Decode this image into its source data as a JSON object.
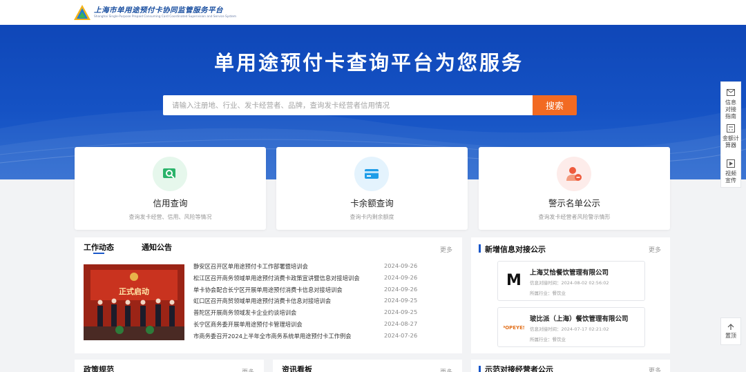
{
  "header": {
    "title": "上海市单用途预付卡协同监管服务平台",
    "subtitle": "Shanghai Single-Purpose Prepaid Consuming Card Coordinated Supervision and Service System"
  },
  "hero": {
    "title": "单用途预付卡查询平台为您服务",
    "search_placeholder": "请输入注册地、行业、发卡经营者、品牌，查询发卡经营者信用情况",
    "search_button": "搜索"
  },
  "cards": [
    {
      "title": "信用查询",
      "desc": "查询发卡经营、信用、风险等情况",
      "icon": "credit-search-icon",
      "color": "#2ab36a"
    },
    {
      "title": "卡余额查询",
      "desc": "查询卡内剩余额度",
      "icon": "card-balance-icon",
      "color": "#1f9de8"
    },
    {
      "title": "警示名单公示",
      "desc": "查询发卡经营者风险警示情形",
      "icon": "warning-person-icon",
      "color": "#ee5b3d"
    }
  ],
  "float": {
    "items": [
      "信息对接指南",
      "金额计算器",
      "视频宣传"
    ],
    "top": "置顶"
  },
  "news": {
    "tabs": [
      "工作动态",
      "通知公告"
    ],
    "more": "更多",
    "image_text": "正式启动",
    "items": [
      {
        "title": "静安区召开区单用途预付卡工作部署暨培训会",
        "date": "2024-09-26"
      },
      {
        "title": "松江区召开商务领域单用途预付消费卡政策宣讲暨信息对接培训会",
        "date": "2024-09-26"
      },
      {
        "title": "单卡协会配合长宁区开展单用途预付消费卡信息对接培训会",
        "date": "2024-09-26"
      },
      {
        "title": "虹口区召开商贸领域单用途预付消费卡信息对接培训会",
        "date": "2024-09-25"
      },
      {
        "title": "普陀区开展商务领域发卡企业约谈培训会",
        "date": "2024-09-25"
      },
      {
        "title": "长宁区商务委开展单用途预付卡管理培训会",
        "date": "2024-08-27"
      },
      {
        "title": "市商务委召开2024上半年全市商务系统单用途预付卡工作例会",
        "date": "2024-07-26"
      }
    ]
  },
  "side": {
    "title": "新增信息对接公示",
    "more": "更多",
    "entries": [
      {
        "name": "上海艾恰餐饮管理有限公司",
        "time": "信息对接时间：2024-08-02 02:56:02",
        "industry": "所属行业：餐饮业",
        "logo_text": "M"
      },
      {
        "name": "玻比派（上海）餐饮管理有限公司",
        "time": "信息对接时间：2024-07-17 02:21:02",
        "industry": "所属行业：餐饮业",
        "logo_text": "POPEYES"
      }
    ]
  },
  "bottom": {
    "panels": [
      "政策规范",
      "资讯看板",
      "示范对接经营者公示"
    ],
    "more": "更多"
  }
}
